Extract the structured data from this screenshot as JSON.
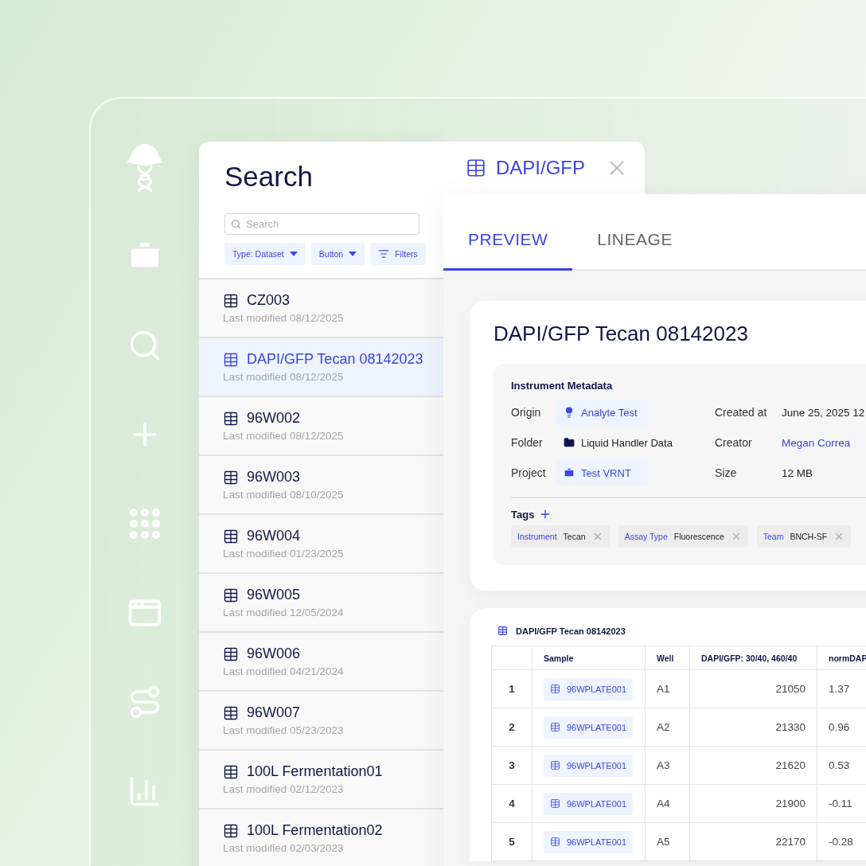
{
  "search_panel": {
    "title": "Search",
    "search": {
      "placeholder": "Search"
    },
    "filters": [
      {
        "label": "Type: Dataset",
        "kind": "dropdown"
      },
      {
        "label": "Button",
        "kind": "dropdown"
      },
      {
        "label": "Filters",
        "kind": "filter"
      }
    ],
    "results": [
      {
        "name": "CZ003",
        "modified": "Last modified 08/12/2025",
        "selected": false
      },
      {
        "name": "DAPI/GFP Tecan 08142023",
        "modified": "Last modified 08/12/2025",
        "selected": true
      },
      {
        "name": "96W002",
        "modified": "Last modified 08/12/2025",
        "selected": false
      },
      {
        "name": "96W003",
        "modified": "Last modified 08/10/2025",
        "selected": false
      },
      {
        "name": "96W004",
        "modified": "Last modified 01/23/2025",
        "selected": false
      },
      {
        "name": "96W005",
        "modified": "Last modified 12/05/2024",
        "selected": false
      },
      {
        "name": "96W006",
        "modified": "Last modified 04/21/2024",
        "selected": false
      },
      {
        "name": "96W007",
        "modified": "Last modified 05/23/2023",
        "selected": false
      },
      {
        "name": "100L Fermentation01",
        "modified": "Last modified 02/12/2023",
        "selected": false
      },
      {
        "name": "100L Fermentation02",
        "modified": "Last modified 02/03/2023",
        "selected": false
      }
    ]
  },
  "open_tab": {
    "title": "DAPI/GFP"
  },
  "view_tabs": [
    {
      "label": "PREVIEW",
      "selected": true
    },
    {
      "label": "LINEAGE",
      "selected": false
    }
  ],
  "dataset": {
    "title": "DAPI/GFP Tecan 08142023",
    "metadata": {
      "title": "Instrument Metadata",
      "left": [
        {
          "label": "Origin",
          "value": "Analyte Test",
          "kind": "origin"
        },
        {
          "label": "Folder",
          "value": "Liquid Handler Data",
          "kind": "folder"
        },
        {
          "label": "Project",
          "value": "Test VRNT",
          "kind": "project"
        }
      ],
      "right": [
        {
          "label": "Created at",
          "value": "June 25, 2025 12",
          "kind": "text"
        },
        {
          "label": "Creator",
          "value": "Megan Correa",
          "kind": "link"
        },
        {
          "label": "Size",
          "value": "12 MB",
          "kind": "text"
        }
      ],
      "tags_label": "Tags",
      "tags": [
        {
          "key": "Instrument",
          "value": "Tecan"
        },
        {
          "key": "Assay Type",
          "value": "Fluorescence"
        },
        {
          "key": "Team",
          "value": "BNCH-SF"
        }
      ]
    }
  },
  "table": {
    "title": "DAPI/GFP Tecan 08142023",
    "columns": [
      "Sample",
      "Well",
      "DAPI/GFP: 30/40, 460/40",
      "normDAP"
    ],
    "rows": [
      {
        "index": "1",
        "sample": "96WPLATE001",
        "well": "A1",
        "value": "21050",
        "norm": "1.37"
      },
      {
        "index": "2",
        "sample": "96WPLATE001",
        "well": "A2",
        "value": "21330",
        "norm": "0.96"
      },
      {
        "index": "3",
        "sample": "96WPLATE001",
        "well": "A3",
        "value": "21620",
        "norm": "0.53"
      },
      {
        "index": "4",
        "sample": "96WPLATE001",
        "well": "A4",
        "value": "21900",
        "norm": "-0.11"
      },
      {
        "index": "5",
        "sample": "96WPLATE001",
        "well": "A5",
        "value": "22170",
        "norm": "-0.28"
      }
    ]
  }
}
